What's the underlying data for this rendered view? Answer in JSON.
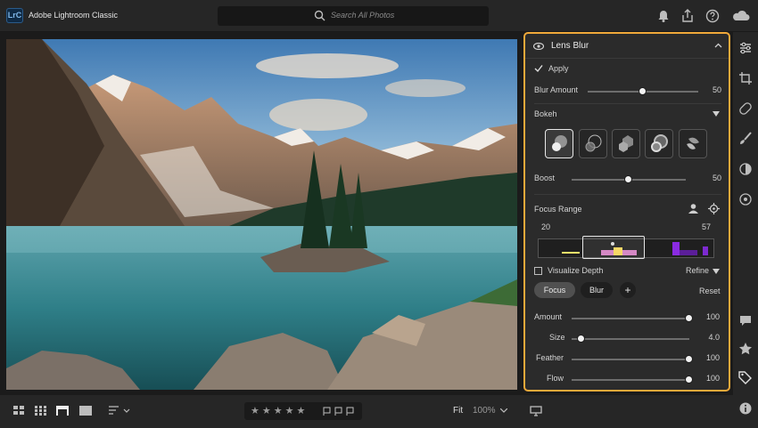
{
  "app": {
    "logo_text": "LrC",
    "name": "Adobe Lightroom Classic"
  },
  "search": {
    "placeholder": "Search All Photos"
  },
  "top_icons": [
    "bell-icon",
    "share-icon",
    "help-icon",
    "cloud-icon"
  ],
  "panel": {
    "title": "Lens Blur",
    "apply_label": "Apply",
    "apply_checked": true,
    "blur_amount": {
      "label": "Blur Amount",
      "value": "50",
      "fraction": 0.5
    },
    "bokeh_label": "Bokeh",
    "bokeh_shapes": [
      "circle",
      "bubble",
      "blade",
      "ring",
      "cat-eye"
    ],
    "boost": {
      "label": "Boost",
      "value": "50",
      "fraction": 0.5
    },
    "focus_range": {
      "label": "Focus Range",
      "min": "20",
      "max": "57"
    },
    "visualize_depth_label": "Visualize Depth",
    "refine_label": "Refine",
    "focus_label": "Focus",
    "blur_label": "Blur",
    "add_label": "+",
    "reset_label": "Reset",
    "sliders": [
      {
        "label": "Amount",
        "value": "100",
        "fraction": 1.0
      },
      {
        "label": "Size",
        "value": "4.0",
        "fraction": 0.08
      },
      {
        "label": "Feather",
        "value": "100",
        "fraction": 1.0
      },
      {
        "label": "Flow",
        "value": "100",
        "fraction": 1.0
      }
    ]
  },
  "right_tools": [
    "edit-icon",
    "crop-icon",
    "healing-icon",
    "brush-icon",
    "masking-icon",
    "red-eye-icon",
    "comment-icon",
    "star-icon",
    "tag-icon",
    "info-icon"
  ],
  "bottom": {
    "fit_label": "Fit",
    "zoom": "100%",
    "stars": "★★★★★"
  },
  "colors": {
    "accent": "#f0a93a",
    "panel": "#2b2b2b",
    "chrome": "#262626"
  }
}
